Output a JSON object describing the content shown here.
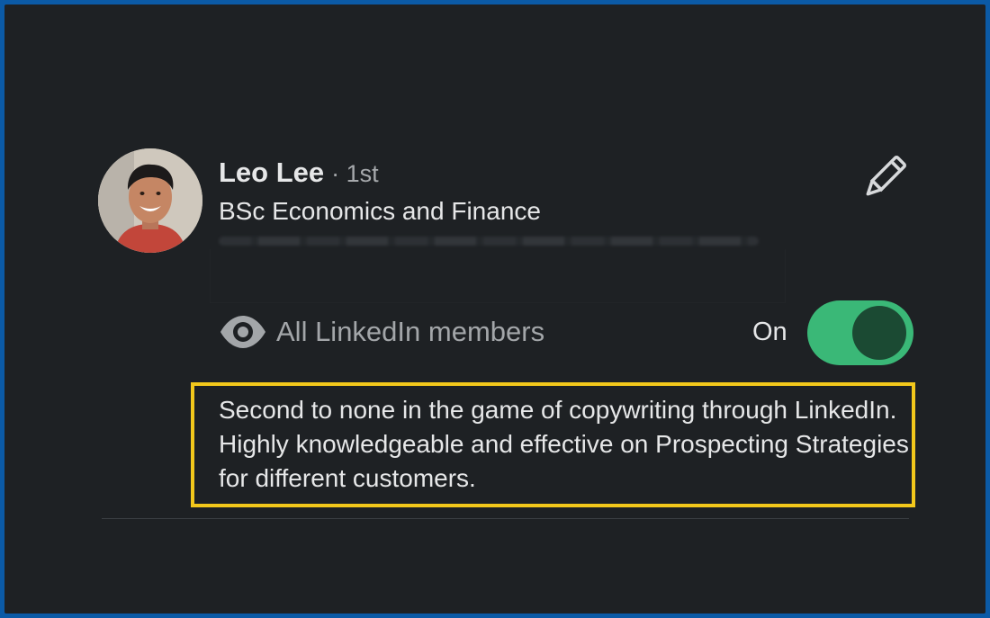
{
  "recommender": {
    "name": "Leo Lee",
    "degree": "· 1st",
    "headline": "BSc Economics and Finance",
    "avatar_icon": "profile-photo"
  },
  "edit": {
    "icon": "pencil-icon"
  },
  "visibility": {
    "icon": "eye-icon",
    "label": "All LinkedIn members",
    "toggle_label": "On",
    "toggle_state": true,
    "toggle_color": "#3ab877"
  },
  "recommendation": {
    "text": "Second to none in the game of copywriting through LinkedIn. Highly knowledgeable and effective on Prospecting Strategies for different customers.",
    "highlight_color": "#f3c81b"
  },
  "theme": {
    "frame_color": "#0b5aa6",
    "background": "#1e2124"
  }
}
